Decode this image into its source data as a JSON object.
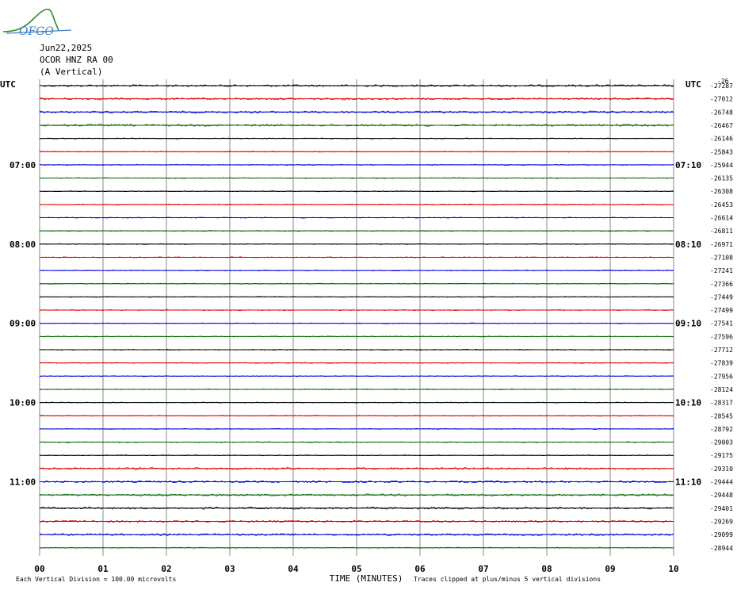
{
  "logo": {
    "text": "OFGO",
    "color": "#3a7fc0",
    "accent": "#2e8b2e"
  },
  "header": {
    "date": "Jun22,2025",
    "station": "OCOR HNZ RA 00",
    "component": "(A Vertical)"
  },
  "chart_data": {
    "type": "line",
    "description_type": "helicorder",
    "utc_label_left": "UTC",
    "utc_label_right": "UTC",
    "start_value_label": "-26",
    "xlabel": "TIME (MINUTES)",
    "x_ticks": [
      "00",
      "01",
      "02",
      "03",
      "04",
      "05",
      "06",
      "07",
      "08",
      "09",
      "10"
    ],
    "xlim": [
      0,
      10
    ],
    "left_time_labels": [
      "07:00",
      "08:00",
      "09:00",
      "10:00",
      "11:00"
    ],
    "right_time_labels": [
      "07:10",
      "08:10",
      "09:10",
      "10:10",
      "11:10"
    ],
    "trace_colors": [
      "#000000",
      "#dd0000",
      "#0000dd",
      "#006600"
    ],
    "trace_offsets": [
      "-27287",
      "-27012",
      "-26748",
      "-26467",
      "-26146",
      "-25843",
      "-25944",
      "-26135",
      "-26308",
      "-26453",
      "-26614",
      "-26811",
      "-26971",
      "-27108",
      "-27241",
      "-27366",
      "-27449",
      "-27499",
      "-27541",
      "-27596",
      "-27712",
      "-27839",
      "-27956",
      "-28124",
      "-28317",
      "-28545",
      "-28792",
      "-29003",
      "-29175",
      "-29310",
      "-29444",
      "-29448",
      "-29401",
      "-29269",
      "-29099",
      "-28944"
    ],
    "grid": true,
    "footer_left": "Each Vertical Division =  100.00 microvolts",
    "footer_right": "Traces clipped at plus/minus 5 vertical divisions"
  }
}
